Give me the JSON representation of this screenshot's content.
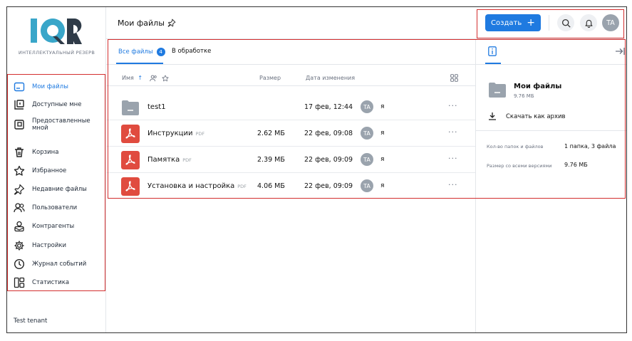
{
  "brand": {
    "logo_text": "IQR",
    "subtitle": "ИНТЕЛЛЕКТУАЛЬНЫЙ РЕЗЕРВ",
    "accent": "#1f7ae0",
    "logo_dark": "#2f3b48",
    "logo_light": "#39a6c9"
  },
  "sidebar": {
    "items": [
      {
        "label": "Мои файлы",
        "icon": "my-files-icon",
        "active": true
      },
      {
        "label": "Доступные мне",
        "icon": "shared-with-me-icon"
      },
      {
        "label": "Предоставленные мной",
        "icon": "shared-by-me-icon"
      },
      {
        "label": "Корзина",
        "icon": "trash-icon"
      },
      {
        "label": "Избранное",
        "icon": "star-icon"
      },
      {
        "label": "Недавние файлы",
        "icon": "pin-icon"
      },
      {
        "label": "Пользователи",
        "icon": "users-icon"
      },
      {
        "label": "Контрагенты",
        "icon": "contractors-icon"
      },
      {
        "label": "Настройки",
        "icon": "gear-icon"
      },
      {
        "label": "Журнал событий",
        "icon": "clock-icon"
      },
      {
        "label": "Статистика",
        "icon": "stats-icon"
      }
    ],
    "tenant": "Test tenant"
  },
  "header": {
    "title": "Мои файлы",
    "create_label": "Создать",
    "create_plus": "+",
    "avatar_initials": "TA"
  },
  "tabs": {
    "all_files": "Все файлы",
    "all_files_count": "4",
    "processing": "В обработке"
  },
  "table": {
    "col_name": "Имя",
    "sort_arrow": "↑",
    "col_size": "Размер",
    "col_date": "Дата изменения",
    "rows": [
      {
        "name": "test1",
        "ext": "",
        "size": "",
        "date": "17 фев, 12:44",
        "avatar": "TA",
        "user": "я",
        "type": "folder"
      },
      {
        "name": "Инструкции",
        "ext": "PDF",
        "size": "2.62 МБ",
        "date": "22 фев, 09:08",
        "avatar": "TA",
        "user": "я",
        "type": "pdf"
      },
      {
        "name": "Памятка",
        "ext": "PDF",
        "size": "2.39 МБ",
        "date": "22 фев, 09:09",
        "avatar": "TA",
        "user": "я",
        "type": "pdf"
      },
      {
        "name": "Установка и настройка",
        "ext": "PDF",
        "size": "4.06 МБ",
        "date": "22 фев, 09:09",
        "avatar": "TA",
        "user": "я",
        "type": "pdf"
      }
    ],
    "more": "···"
  },
  "details": {
    "title": "Мои файлы",
    "size": "9.76 МБ",
    "download": "Скачать как архив",
    "count_key": "Кол-во папок и файлов",
    "count_value": "1 папка, 3 файла",
    "versions_key": "Размер со всеми версиями",
    "versions_value": "9.76 МБ"
  },
  "colors": {
    "pdf": "#e04b3f",
    "folder": "#9aa3ad",
    "highlight": "#d32f2f"
  }
}
